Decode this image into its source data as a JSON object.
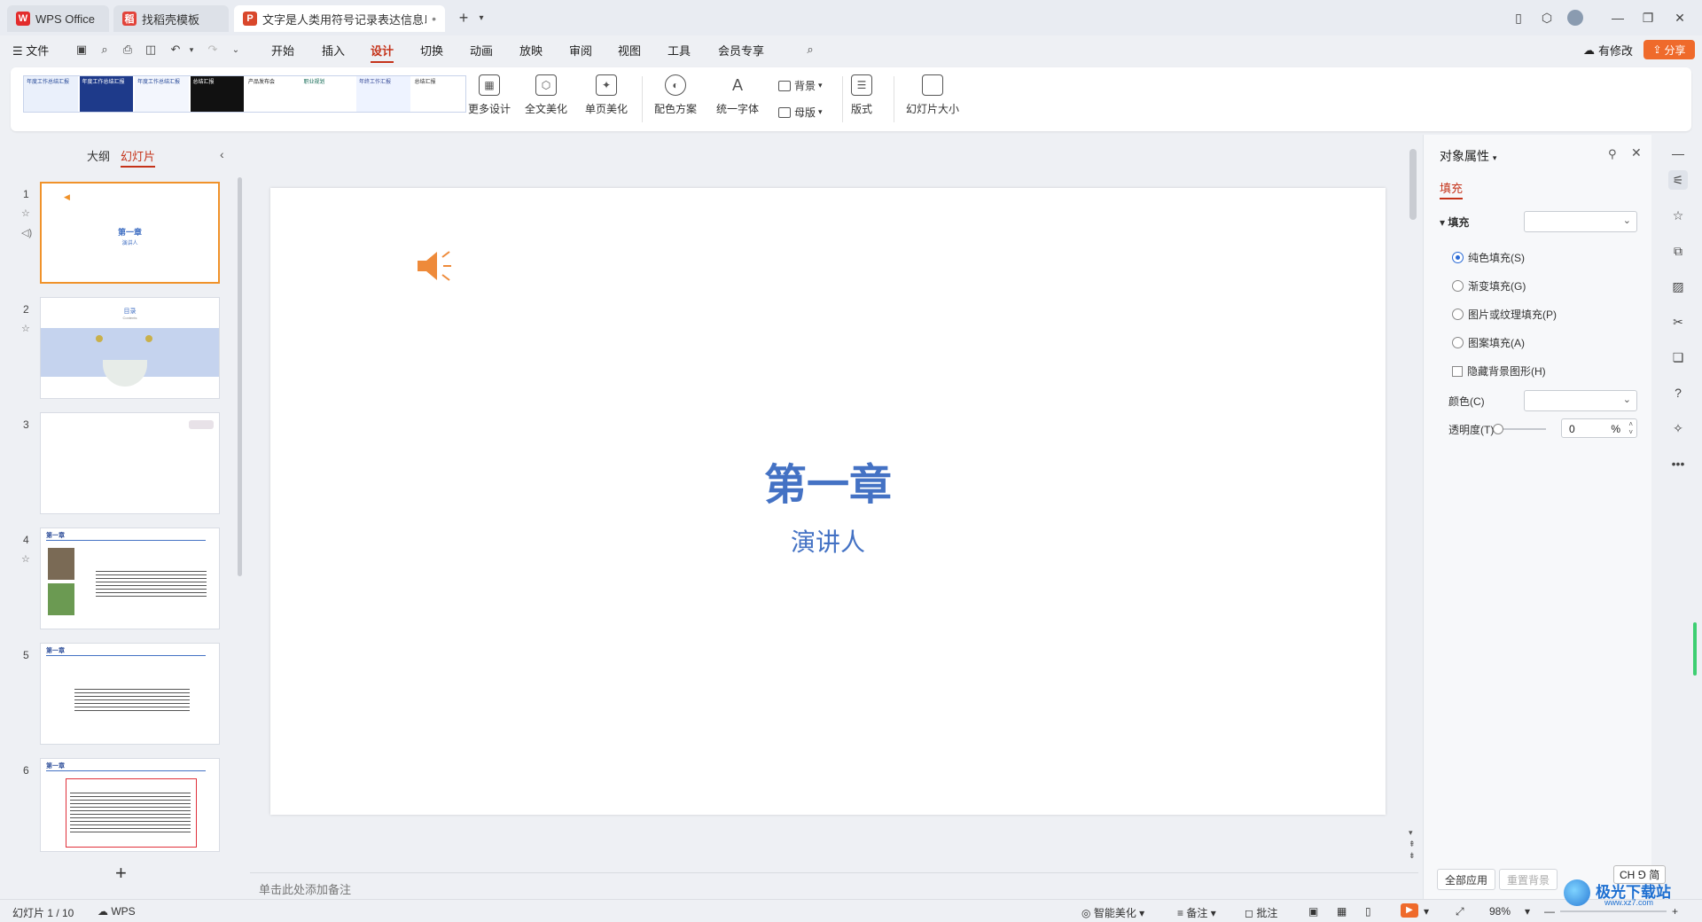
{
  "tabs": [
    {
      "label": "WPS Office",
      "icon": "wps-logo-icon"
    },
    {
      "label": "找稻壳模板",
      "icon": "docer-icon"
    },
    {
      "label": "文字是人类用符号记录表达信息以",
      "icon": "ppt-icon"
    }
  ],
  "window_controls": {
    "minimize": "—",
    "restore": "❐",
    "close": "✕"
  },
  "menu": {
    "file": "文件",
    "items": [
      "开始",
      "插入",
      "设计",
      "切换",
      "动画",
      "放映",
      "审阅",
      "视图",
      "工具",
      "会员专享"
    ],
    "active": "设计",
    "modified_label": "有修改",
    "share_label": "分享"
  },
  "ribbon": {
    "templates": [
      "年度工作总结汇报",
      "年度工作总结汇报",
      "年度工作总结汇报",
      "总结汇报",
      "产品发布会",
      "职业规划",
      "年终工作汇报",
      "总结汇报"
    ],
    "more_design": "更多设计",
    "full_beautify": "全文美化",
    "single_beautify": "单页美化",
    "color_scheme": "配色方案",
    "unify_font": "统一字体",
    "background": "背景",
    "master": "母版",
    "layout": "版式",
    "slide_size": "幻灯片大小"
  },
  "left_panel": {
    "outline_tab": "大纲",
    "slides_tab": "幻灯片",
    "slides": [
      {
        "num": "1",
        "title": "第一章",
        "subtitle": "演讲人"
      },
      {
        "num": "2",
        "title": "目录",
        "subtitle": "Contents"
      },
      {
        "num": "3",
        "title": "",
        "subtitle": ""
      },
      {
        "num": "4",
        "title": "第一章",
        "subtitle": ""
      },
      {
        "num": "5",
        "title": "第一章",
        "subtitle": ""
      },
      {
        "num": "6",
        "title": "第一章",
        "subtitle": ""
      }
    ]
  },
  "slide": {
    "title": "第一章",
    "subtitle": "演讲人"
  },
  "notes_placeholder": "单击此处添加备注",
  "right_panel": {
    "title": "对象属性",
    "fill_tab": "填充",
    "fill_section": "填充",
    "options": [
      "纯色填充(S)",
      "渐变填充(G)",
      "图片或纹理填充(P)",
      "图案填充(A)"
    ],
    "selected_option": "纯色填充(S)",
    "hide_bg": "隐藏背景图形(H)",
    "color_label": "颜色(C)",
    "transparency_label": "透明度(T)",
    "transparency_value": "0",
    "transparency_unit": "%",
    "apply_all": "全部应用",
    "reset_bg": "重置背景"
  },
  "status": {
    "slide_count": "幻灯片 1 / 10",
    "wps": "WPS",
    "smart_beautify": "智能美化",
    "notes": "备注",
    "comments": "批注",
    "zoom": "98%",
    "ime": "CH ⅁ 简",
    "watermark": "极光下载站",
    "watermark_url": "www.xz7.com"
  },
  "colors": {
    "accent": "#c5331a",
    "brand_orange": "#f0922a",
    "title_blue": "#4472c4",
    "share_bg": "#ef6a2b"
  }
}
